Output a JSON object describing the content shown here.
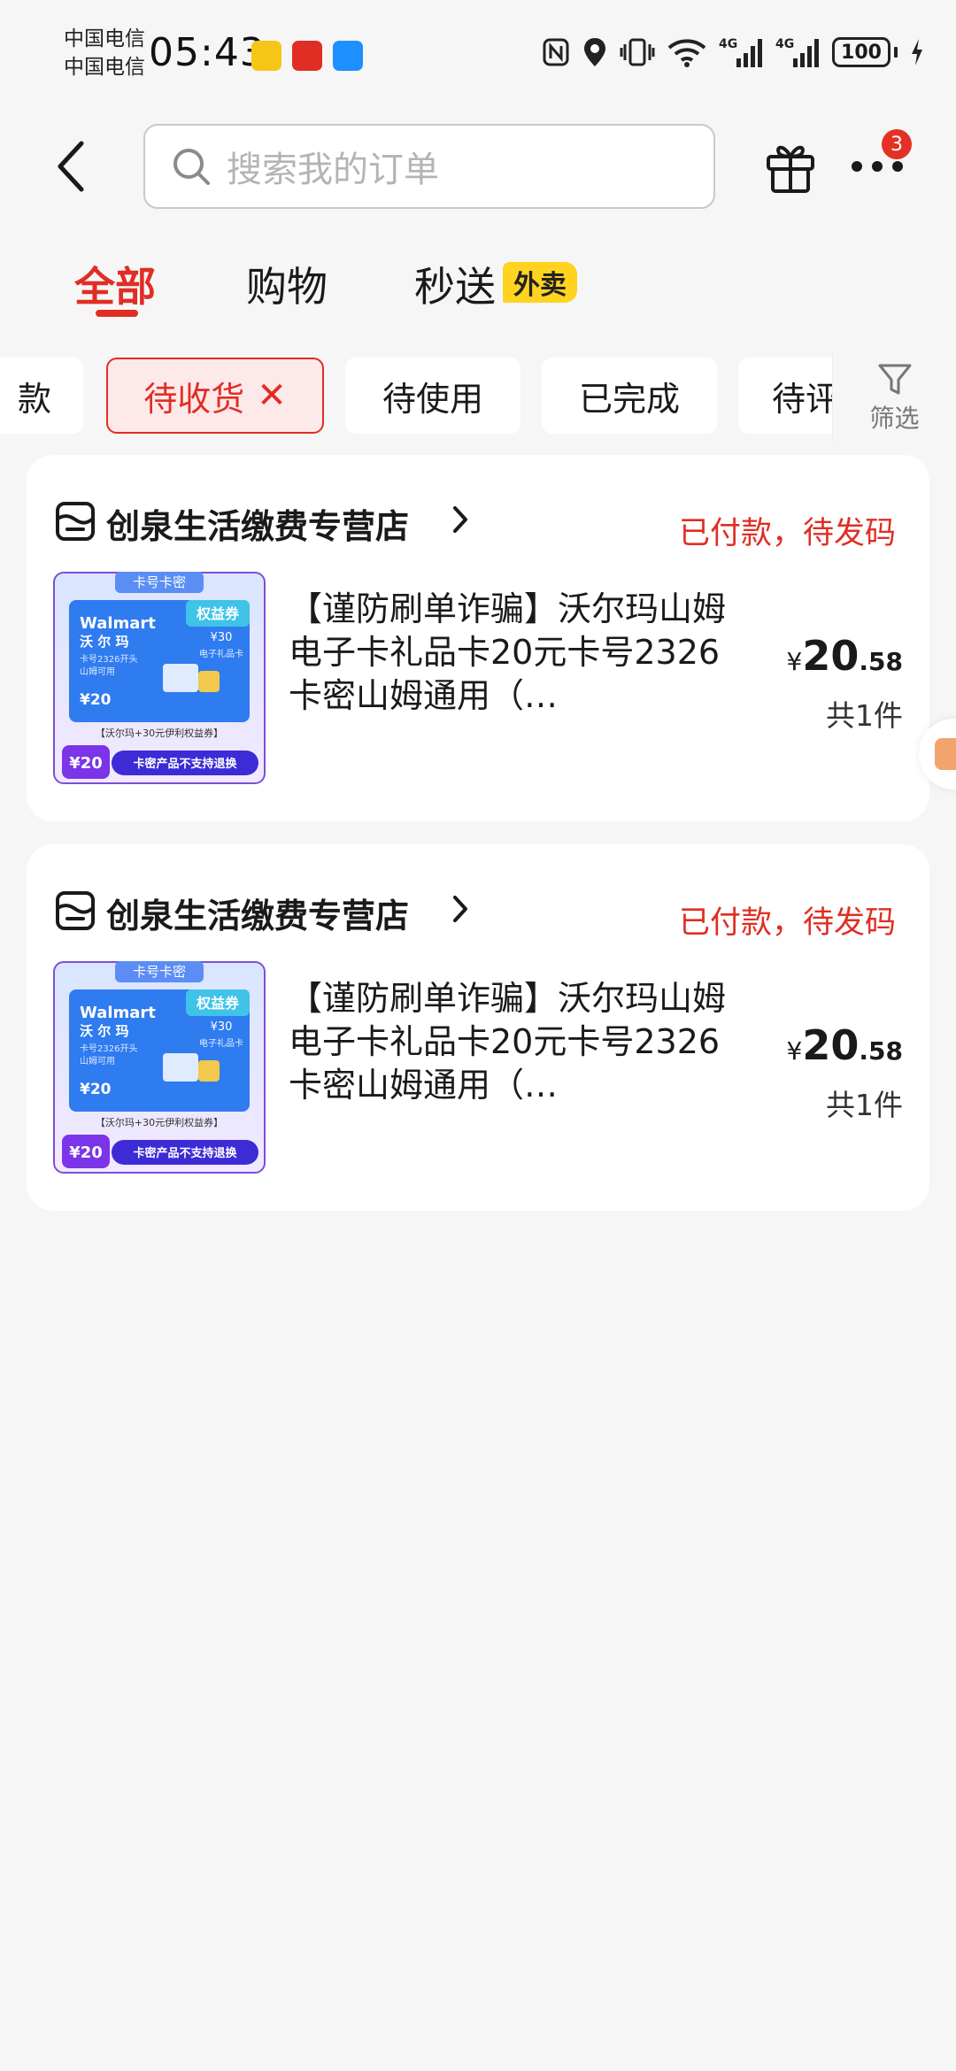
{
  "status_bar": {
    "carrier_1": "中国电信",
    "carrier_2": "中国电信",
    "time": "05:43",
    "network_1": "4G",
    "network_2": "4G",
    "battery": "100"
  },
  "header": {
    "search_placeholder": "搜索我的订单",
    "notification_count": "3"
  },
  "tabs": [
    {
      "label": "全部",
      "active": true
    },
    {
      "label": "购物",
      "active": false
    },
    {
      "label": "秒送",
      "active": false,
      "badge": "外卖"
    }
  ],
  "filters": {
    "chips": [
      {
        "label": "款",
        "active": false
      },
      {
        "label": "待收货",
        "active": true
      },
      {
        "label": "待使用",
        "active": false
      },
      {
        "label": "已完成",
        "active": false
      },
      {
        "label": "待评",
        "active": false
      }
    ],
    "close_symbol": "✕",
    "filter_label": "筛选"
  },
  "orders": [
    {
      "store_name": "创泉生活缴费专营店",
      "status": "已付款，待发码",
      "title": "【谨防刷单诈骗】沃尔玛山姆电子卡礼品卡20元卡号2326卡密山姆通用（…",
      "price_symbol": "¥",
      "price_int": "20",
      "price_dec": ".58",
      "quantity": "共1件",
      "thumb": {
        "top_label": "卡号卡密",
        "brand": "Walmart",
        "brand_cn": "沃 尔 玛",
        "card_note": "卡号2326开头",
        "card_note2": "山姆可用",
        "card_value": "¥20",
        "rights_label": "权益券",
        "rights_value": "¥30",
        "gift_label": "电子礼品卡",
        "promo": "【沃尔玛+30元伊利权益券】",
        "price_tag": "¥20",
        "warn": "卡密产品不支持退换"
      }
    },
    {
      "store_name": "创泉生活缴费专营店",
      "status": "已付款，待发码",
      "title": "【谨防刷单诈骗】沃尔玛山姆电子卡礼品卡20元卡号2326卡密山姆通用（…",
      "price_symbol": "¥",
      "price_int": "20",
      "price_dec": ".58",
      "quantity": "共1件",
      "thumb": {
        "top_label": "卡号卡密",
        "brand": "Walmart",
        "brand_cn": "沃 尔 玛",
        "card_note": "卡号2326开头",
        "card_note2": "山姆可用",
        "card_value": "¥20",
        "rights_label": "权益券",
        "rights_value": "¥30",
        "gift_label": "电子礼品卡",
        "promo": "【沃尔玛+30元伊利权益券】",
        "price_tag": "¥20",
        "warn": "卡密产品不支持退换"
      }
    }
  ]
}
